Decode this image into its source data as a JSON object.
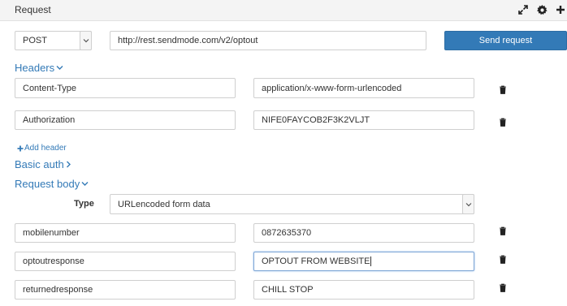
{
  "panel": {
    "title": "Request",
    "icons": [
      "expand-icon",
      "gear-icon",
      "plus-icon"
    ]
  },
  "request_line": {
    "method": "POST",
    "url": "http://rest.sendmode.com/v2/optout",
    "send_label": "Send request"
  },
  "headers": {
    "title": "Headers",
    "rows": [
      {
        "name": "Content-Type",
        "value": "application/x-www-form-urlencoded"
      },
      {
        "name": "Authorization",
        "value": "NIFE0FAYCOB2F3K2VLJT"
      }
    ],
    "add_label": "Add header"
  },
  "basic_auth": {
    "title": "Basic auth"
  },
  "request_body": {
    "title": "Request body",
    "type_label": "Type",
    "type_value": "URLencoded form data",
    "rows": [
      {
        "name": "mobilenumber",
        "value": "0872635370"
      },
      {
        "name": "optoutresponse",
        "value": "OPTOUT FROM WEBSITE"
      },
      {
        "name": "returnedresponse",
        "value": "CHILL STOP"
      }
    ]
  }
}
